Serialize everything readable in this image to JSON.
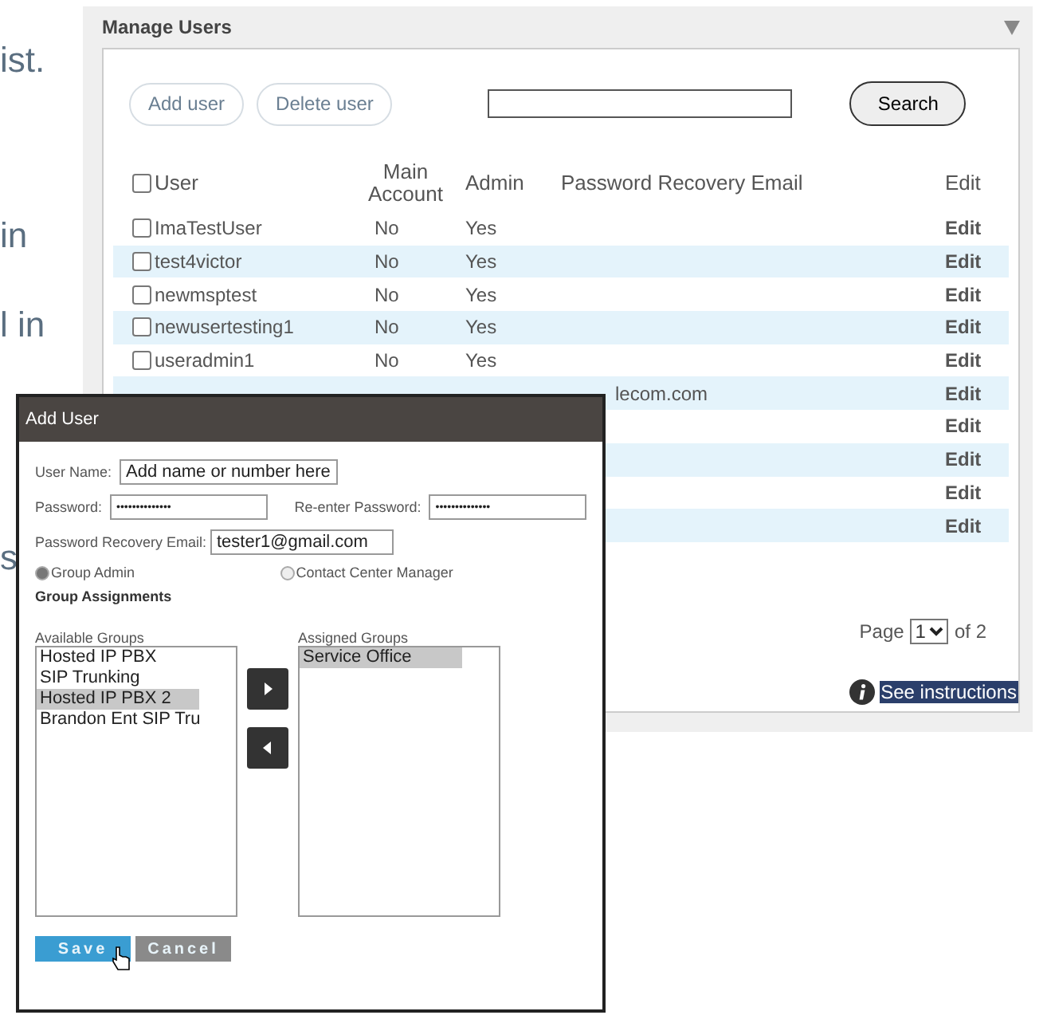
{
  "background_text": [
    "ist.",
    "in",
    "l in",
    "s"
  ],
  "manage_users": {
    "title": "Manage Users",
    "buttons": [
      "Add user",
      "Delete user"
    ],
    "search_button": "Search",
    "select_all_checked": false,
    "columns": [
      "User",
      "Main Account",
      "Admin",
      "Password Recovery Email",
      "Edit"
    ],
    "rows": [
      {
        "user": "ImaTestUser",
        "main_account": "No",
        "admin": "Yes",
        "edit": "Edit",
        "checked": false
      },
      {
        "user": "test4victor",
        "main_account": "No",
        "admin": "Yes",
        "edit": "Edit",
        "checked": false
      },
      {
        "user": "newmsptest",
        "main_account": "No",
        "admin": "Yes",
        "edit": "Edit",
        "checked": false
      },
      {
        "user": "newusertesting1",
        "main_account": "No",
        "admin": "Yes",
        "edit": "Edit",
        "checked": false
      },
      {
        "user": "useradmin1",
        "main_account": "No",
        "admin": "Yes",
        "edit": "Edit",
        "checked": false
      },
      {
        "email": "lecom.com",
        "edit": "Edit"
      },
      {
        "edit": "Edit"
      },
      {
        "edit": "Edit"
      },
      {
        "edit": "Edit"
      },
      {
        "edit": "Edit"
      }
    ],
    "pagination": {
      "label": "Page",
      "page": "1",
      "total": "of 2"
    },
    "instructions": "See instructions"
  },
  "dialog": {
    "title": "Add User",
    "user_name": {
      "label": "User Name:",
      "value": "Add name or number here"
    },
    "password": {
      "label": "Password:",
      "value": "••••••••••••••"
    },
    "reenter_password": {
      "label": "Re-enter Password:",
      "value": "••••••••••••••"
    },
    "recovery_email": {
      "label": "Password Recovery Email:",
      "value": "tester1@gmail.com"
    },
    "roles": [
      {
        "label": "Group Admin",
        "selected": true
      },
      {
        "label": "Contact Center Manager",
        "selected": false
      }
    ],
    "group_assignments": "Group Assignments",
    "available": {
      "label": "Available Groups",
      "items": [
        {
          "label": "Hosted IP PBX",
          "selected": false
        },
        {
          "label": "SIP Trunking",
          "selected": false
        },
        {
          "label": "Hosted IP PBX 2",
          "selected": true
        },
        {
          "label": "Brandon Ent SIP Tru",
          "selected": false
        }
      ]
    },
    "assigned": {
      "label": "Assigned Groups",
      "items": [
        {
          "label": "Service Office",
          "selected": true
        }
      ]
    },
    "buttons": [
      "Save",
      "Cancel"
    ]
  }
}
